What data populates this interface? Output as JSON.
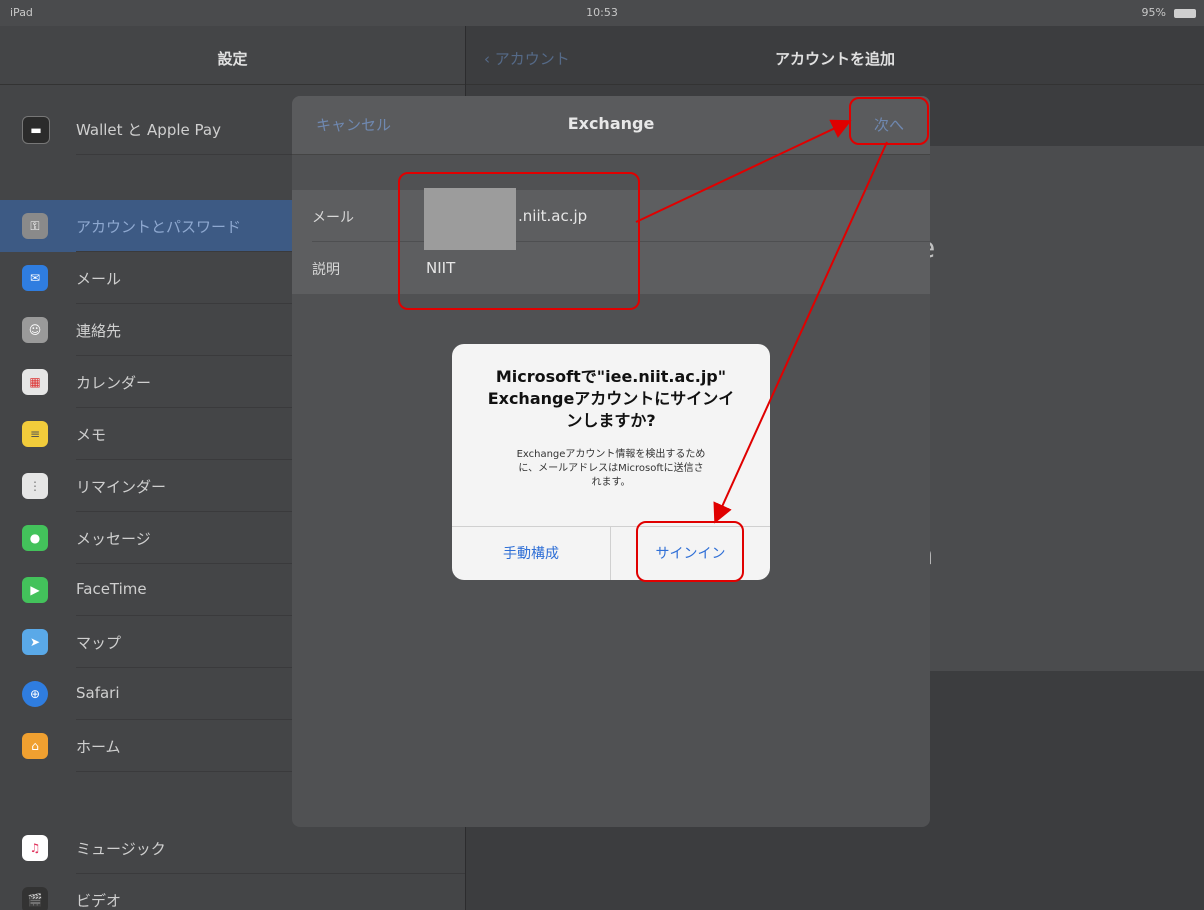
{
  "status": {
    "left": "iPad",
    "time": "10:53",
    "right": "95%"
  },
  "settings": {
    "title": "設定",
    "items": [
      {
        "label": "Wallet と Apple Pay",
        "icon": "wallet-icon",
        "color": "#2b2b2b"
      },
      {
        "label": "アカウントとパスワード",
        "icon": "key-icon",
        "color": "#8a8a8a"
      },
      {
        "label": "メール",
        "icon": "mail-icon",
        "color": "#2f7de0"
      },
      {
        "label": "連絡先",
        "icon": "contacts-icon",
        "color": "#9a9a9a"
      },
      {
        "label": "カレンダー",
        "icon": "calendar-icon",
        "color": "#e6e6e6"
      },
      {
        "label": "メモ",
        "icon": "notes-icon",
        "color": "#f2cc3b"
      },
      {
        "label": "リマインダー",
        "icon": "reminders-icon",
        "color": "#e6e6e6"
      },
      {
        "label": "メッセージ",
        "icon": "messages-icon",
        "color": "#43c25b"
      },
      {
        "label": "FaceTime",
        "icon": "facetime-icon",
        "color": "#43c25b"
      },
      {
        "label": "マップ",
        "icon": "maps-icon",
        "color": "#5aa9e8"
      },
      {
        "label": "Safari",
        "icon": "safari-icon",
        "color": "#2f7de0"
      },
      {
        "label": "ホーム",
        "icon": "home-icon",
        "color": "#f0a030"
      },
      {
        "label": "ミュージック",
        "icon": "music-icon",
        "color": "#ffffff"
      },
      {
        "label": "ビデオ",
        "icon": "video-icon",
        "color": "#333333"
      }
    ]
  },
  "detail": {
    "back_label": "アカウント",
    "title": "アカウントを追加",
    "fragment_1": "e",
    "fragment_2": "m"
  },
  "sheet": {
    "cancel": "キャンセル",
    "title": "Exchange",
    "next": "次へ",
    "email_label": "メール",
    "email_value": ".niit.ac.jp",
    "desc_label": "説明",
    "desc_value": "NIIT"
  },
  "alert": {
    "title": "Microsoftで\"iee.niit.ac.jp\"\nExchangeアカウントにサインイ\nンしますか?",
    "message": "Exchangeアカウント情報を検出するため\nに、メールアドレスはMicrosoftに送信さ\nれます。",
    "manual": "手動構成",
    "signin": "サインイン"
  },
  "colors": {
    "annotation": "#e00000",
    "ios_blue": "#2f6fd6"
  }
}
